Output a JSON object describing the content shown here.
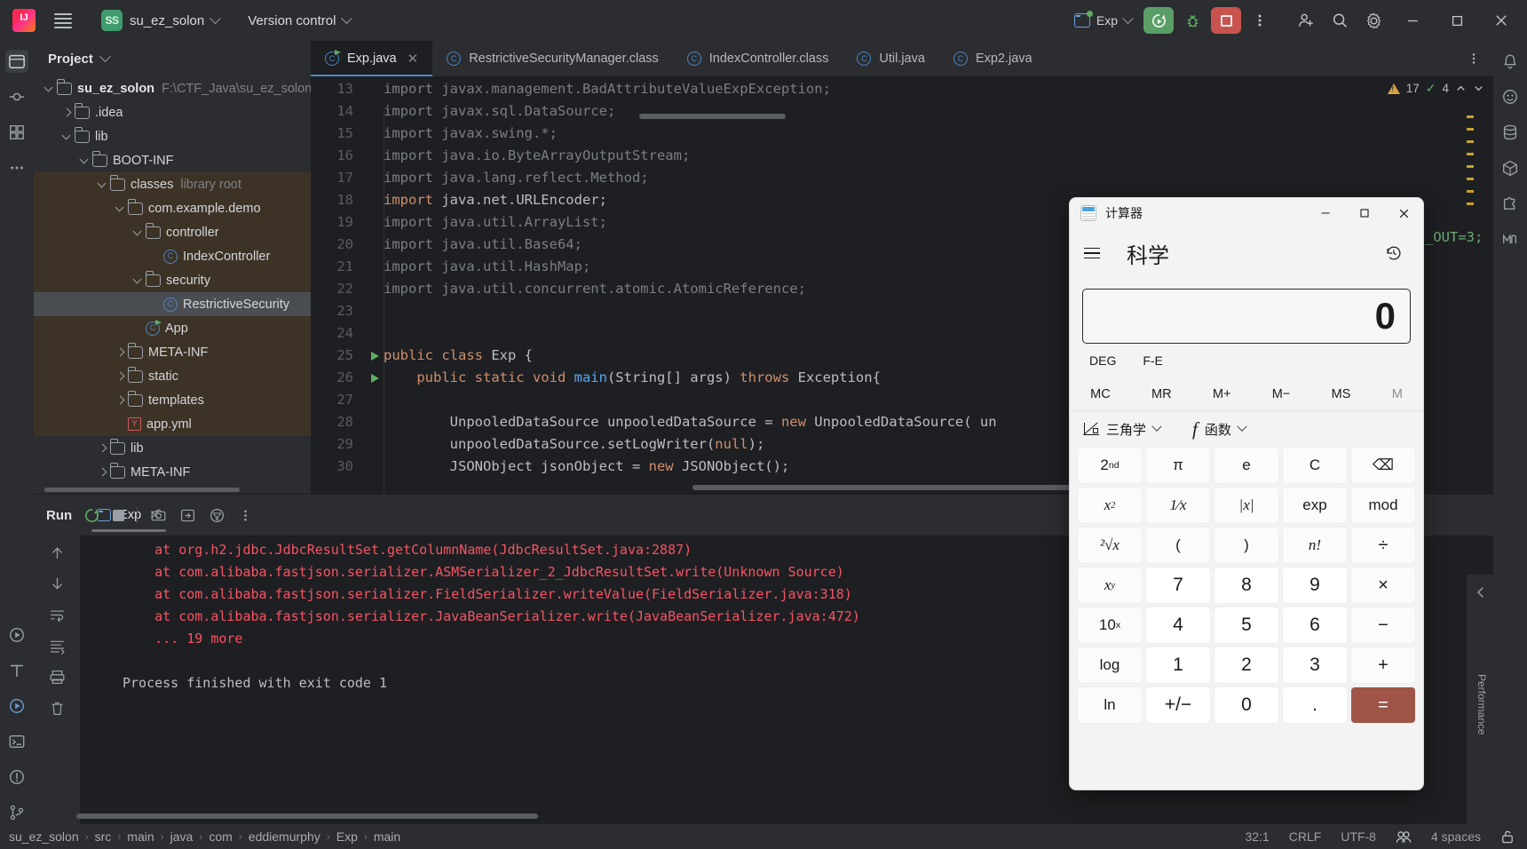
{
  "toolbar": {
    "project_badge": "SS",
    "project_name": "su_ez_solon",
    "version_control": "Version control",
    "run_config": "Exp",
    "icons": [
      "run-icon",
      "debug-icon",
      "stop-icon",
      "more-actions-icon",
      "add-collaborator-icon",
      "search-everywhere-icon",
      "settings-icon"
    ],
    "window": {
      "minimize": "—",
      "maximize": "□",
      "close": "✕"
    }
  },
  "project_panel": {
    "title": "Project",
    "tree": [
      {
        "depth": 0,
        "twisty": "down",
        "icon": "project-folder",
        "label": "su_ez_solon",
        "bold": true,
        "path": "F:\\CTF_Java\\su_ez_solon",
        "state": "normal"
      },
      {
        "depth": 1,
        "twisty": "right",
        "icon": "folder",
        "label": ".idea",
        "state": "normal"
      },
      {
        "depth": 1,
        "twisty": "down",
        "icon": "folder",
        "label": "lib",
        "state": "normal"
      },
      {
        "depth": 2,
        "twisty": "down",
        "icon": "folder",
        "label": "BOOT-INF",
        "state": "normal"
      },
      {
        "depth": 3,
        "twisty": "down",
        "icon": "folder",
        "label": "classes",
        "meta": "library root",
        "state": "lib"
      },
      {
        "depth": 4,
        "twisty": "down",
        "icon": "folder",
        "label": "com.example.demo",
        "state": "lib"
      },
      {
        "depth": 5,
        "twisty": "down",
        "icon": "folder",
        "label": "controller",
        "state": "lib"
      },
      {
        "depth": 6,
        "twisty": "none",
        "icon": "class",
        "label": "IndexController",
        "state": "lib"
      },
      {
        "depth": 5,
        "twisty": "down",
        "icon": "folder",
        "label": "security",
        "state": "lib"
      },
      {
        "depth": 6,
        "twisty": "none",
        "icon": "class",
        "label": "RestrictiveSecurity",
        "state": "selected"
      },
      {
        "depth": 5,
        "twisty": "none",
        "icon": "class-run",
        "label": "App",
        "state": "lib"
      },
      {
        "depth": 4,
        "twisty": "right",
        "icon": "folder",
        "label": "META-INF",
        "state": "lib"
      },
      {
        "depth": 4,
        "twisty": "right",
        "icon": "folder",
        "label": "static",
        "state": "lib"
      },
      {
        "depth": 4,
        "twisty": "right",
        "icon": "folder",
        "label": "templates",
        "state": "lib"
      },
      {
        "depth": 4,
        "twisty": "none",
        "icon": "yaml",
        "label": "app.yml",
        "state": "lib"
      },
      {
        "depth": 3,
        "twisty": "right",
        "icon": "folder",
        "label": "lib",
        "state": "normal"
      },
      {
        "depth": 3,
        "twisty": "right",
        "icon": "folder",
        "label": "META-INF",
        "state": "normal"
      }
    ]
  },
  "editor": {
    "tabs": [
      {
        "label": "Exp.java",
        "icon": "java-class-run-icon",
        "active": true,
        "closable": true
      },
      {
        "label": "RestrictiveSecurityManager.class",
        "icon": "class-icon",
        "active": false
      },
      {
        "label": "IndexController.class",
        "icon": "class-icon",
        "active": false
      },
      {
        "label": "Util.java",
        "icon": "class-icon",
        "active": false
      },
      {
        "label": "Exp2.java",
        "icon": "class-icon",
        "active": false
      }
    ],
    "inspections": {
      "warnings": "17",
      "checks": "4"
    },
    "lines": [
      {
        "n": "13",
        "run": false,
        "segs": [
          [
            "dim",
            "import javax.management.BadAttributeValueExpException;"
          ]
        ]
      },
      {
        "n": "14",
        "run": false,
        "segs": [
          [
            "dim",
            "import javax.sql.DataSource;"
          ]
        ]
      },
      {
        "n": "15",
        "run": false,
        "segs": [
          [
            "dim",
            "import javax.swing.*;"
          ]
        ]
      },
      {
        "n": "16",
        "run": false,
        "segs": [
          [
            "dim",
            "import java.io.ByteArrayOutputStream;"
          ]
        ]
      },
      {
        "n": "17",
        "run": false,
        "segs": [
          [
            "dim",
            "import java.lang.reflect.Method;"
          ]
        ]
      },
      {
        "n": "18",
        "run": false,
        "segs": [
          [
            "k",
            "import "
          ],
          [
            "t",
            "java.net.URLEncoder;"
          ]
        ]
      },
      {
        "n": "19",
        "run": false,
        "segs": [
          [
            "dim",
            "import java.util.ArrayList;"
          ]
        ]
      },
      {
        "n": "20",
        "run": false,
        "segs": [
          [
            "dim",
            "import java.util.Base64;"
          ]
        ]
      },
      {
        "n": "21",
        "run": false,
        "segs": [
          [
            "dim",
            "import java.util.HashMap;"
          ]
        ]
      },
      {
        "n": "22",
        "run": false,
        "segs": [
          [
            "dim",
            "import java.util.concurrent.atomic.AtomicReference;"
          ]
        ]
      },
      {
        "n": "23",
        "run": false,
        "segs": []
      },
      {
        "n": "24",
        "run": false,
        "segs": []
      },
      {
        "n": "25",
        "run": true,
        "segs": [
          [
            "k",
            "public class "
          ],
          [
            "t",
            "Exp {"
          ]
        ]
      },
      {
        "n": "26",
        "run": true,
        "segs": [
          [
            "t",
            "    "
          ],
          [
            "k",
            "public static void "
          ],
          [
            "m",
            "main"
          ],
          [
            "t",
            "(String[] args) "
          ],
          [
            "k",
            "throws "
          ],
          [
            "t",
            "Exception{"
          ]
        ]
      },
      {
        "n": "27",
        "run": false,
        "segs": []
      },
      {
        "n": "28",
        "run": false,
        "segs": [
          [
            "t",
            "        UnpooledDataSource unpooledDataSource = "
          ],
          [
            "k",
            "new "
          ],
          [
            "t",
            "UnpooledDataSource( un"
          ]
        ]
      },
      {
        "n": "29",
        "run": false,
        "segs": [
          [
            "t",
            "        unpooledDataSource.setLogWriter("
          ],
          [
            "k",
            "null"
          ],
          [
            "t",
            ");"
          ]
        ]
      },
      {
        "n": "30",
        "run": false,
        "segs": [
          [
            "t",
            "        JSONObject jsonObject = "
          ],
          [
            "k",
            "new "
          ],
          [
            "t",
            "JSONObject();"
          ]
        ]
      }
    ],
    "overflow_code": "_OUT=3;"
  },
  "run_panel": {
    "title": "Run",
    "tab": "Exp",
    "console": [
      {
        "cls": "err",
        "text": "    at org.h2.jdbc.JdbcResultSet.getColumnName(JdbcResultSet.java:2887)"
      },
      {
        "cls": "err",
        "text": "    at com.alibaba.fastjson.serializer.ASMSerializer_2_JdbcResultSet.write(Unknown Source)"
      },
      {
        "cls": "err",
        "text": "    at com.alibaba.fastjson.serializer.FieldSerializer.writeValue(FieldSerializer.java:318)"
      },
      {
        "cls": "err",
        "text": "    at com.alibaba.fastjson.serializer.JavaBeanSerializer.write(JavaBeanSerializer.java:472)"
      },
      {
        "cls": "err",
        "text": "    ... 19 more"
      },
      {
        "cls": "out",
        "text": ""
      },
      {
        "cls": "out",
        "text": "Process finished with exit code 1"
      }
    ],
    "performance_label": "Performance"
  },
  "status_bar": {
    "breadcrumbs": [
      "su_ez_solon",
      "src",
      "main",
      "java",
      "com",
      "eddiemurphy",
      "Exp",
      "main"
    ],
    "caret": "32:1",
    "line_separator": "CRLF",
    "encoding": "UTF-8",
    "indent": "4 spaces"
  },
  "calculator": {
    "title": "计算器",
    "mode": "科学",
    "display_value": "0",
    "angle_unit": "DEG",
    "fe_toggle": "F-E",
    "memory": [
      "MC",
      "MR",
      "M+",
      "M−",
      "MS",
      "M"
    ],
    "function_groups": [
      {
        "label": "三角学",
        "icon": "trigonometry-icon"
      },
      {
        "label": "函数",
        "icon": "function-fx-icon"
      }
    ],
    "keys": [
      {
        "label": "2nd",
        "type": "fn",
        "sup": "nd",
        "base": "2"
      },
      {
        "label": "π",
        "type": "fn"
      },
      {
        "label": "e",
        "type": "fn"
      },
      {
        "label": "C",
        "type": "fn"
      },
      {
        "label": "⌫",
        "type": "fn",
        "name": "backspace-icon"
      },
      {
        "label": "x2",
        "type": "fn",
        "italic": true,
        "sup": "2",
        "base": "x"
      },
      {
        "label": "1⁄x",
        "type": "fn",
        "italic": true
      },
      {
        "label": "|x|",
        "type": "fn",
        "italic": true
      },
      {
        "label": "exp",
        "type": "fn"
      },
      {
        "label": "mod",
        "type": "fn"
      },
      {
        "label": "²√x",
        "type": "fn",
        "italic": true
      },
      {
        "label": "(",
        "type": "fn"
      },
      {
        "label": ")",
        "type": "fn"
      },
      {
        "label": "n!",
        "type": "fn",
        "italic": true
      },
      {
        "label": "÷",
        "type": "op"
      },
      {
        "label": "xy",
        "type": "fn",
        "italic": true,
        "sup": "y",
        "base": "x"
      },
      {
        "label": "7",
        "type": "num"
      },
      {
        "label": "8",
        "type": "num"
      },
      {
        "label": "9",
        "type": "num"
      },
      {
        "label": "×",
        "type": "op"
      },
      {
        "label": "10x",
        "type": "fn",
        "sup": "x",
        "base": "10"
      },
      {
        "label": "4",
        "type": "num"
      },
      {
        "label": "5",
        "type": "num"
      },
      {
        "label": "6",
        "type": "num"
      },
      {
        "label": "−",
        "type": "op"
      },
      {
        "label": "log",
        "type": "fn"
      },
      {
        "label": "1",
        "type": "num"
      },
      {
        "label": "2",
        "type": "num"
      },
      {
        "label": "3",
        "type": "num"
      },
      {
        "label": "+",
        "type": "op"
      },
      {
        "label": "ln",
        "type": "fn"
      },
      {
        "label": "+/−",
        "type": "num"
      },
      {
        "label": "0",
        "type": "num"
      },
      {
        "label": ".",
        "type": "num"
      },
      {
        "label": "=",
        "type": "eq"
      }
    ]
  },
  "colors": {
    "accent": "#4a88c7",
    "run_green": "#5a9e68",
    "stop_red": "#c9534f",
    "error_red": "#f75464",
    "library_bg": "#3c3326",
    "equals_brown": "#9e5548"
  }
}
